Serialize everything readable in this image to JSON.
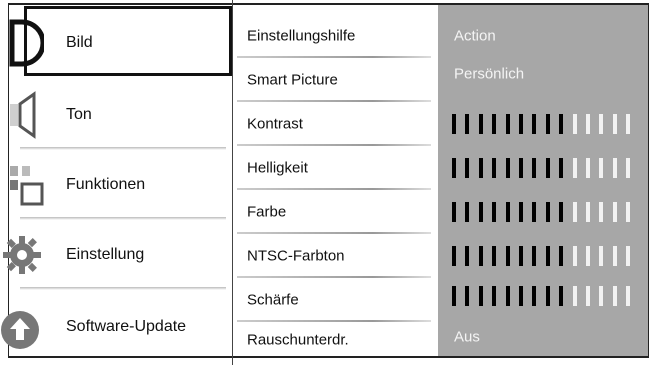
{
  "menu": [
    {
      "label": "Bild",
      "icon": "picture-icon",
      "selected": true
    },
    {
      "label": "Ton",
      "icon": "speaker-icon",
      "selected": false
    },
    {
      "label": "Funktionen",
      "icon": "features-icon",
      "selected": false
    },
    {
      "label": "Einstellung",
      "icon": "gear-icon",
      "selected": false
    },
    {
      "label": "Software-Update",
      "icon": "update-arrow-icon",
      "selected": false
    }
  ],
  "options": [
    {
      "label": "Einstellungshilfe"
    },
    {
      "label": "Smart Picture"
    },
    {
      "label": "Kontrast"
    },
    {
      "label": "Helligkeit"
    },
    {
      "label": "Farbe"
    },
    {
      "label": "NTSC-Farbton"
    },
    {
      "label": "Schärfe"
    },
    {
      "label": "Rauschunterdr."
    }
  ],
  "values": [
    {
      "type": "text",
      "text": "Action"
    },
    {
      "type": "text",
      "text": "Persönlich"
    },
    {
      "type": "slider",
      "filled_ticks": 9,
      "total_ticks": 14
    },
    {
      "type": "slider",
      "filled_ticks": 9,
      "total_ticks": 14
    },
    {
      "type": "slider",
      "filled_ticks": 9,
      "total_ticks": 14
    },
    {
      "type": "slider",
      "filled_ticks": 9,
      "total_ticks": 14
    },
    {
      "type": "slider",
      "filled_ticks": 9,
      "total_ticks": 14
    },
    {
      "type": "text",
      "text": "Aus"
    }
  ],
  "colors": {
    "panel": "#a7a7a7",
    "text_on_panel": "#f4f4f4",
    "tick_on": "#000000",
    "tick_off": "#f2f2f2"
  }
}
